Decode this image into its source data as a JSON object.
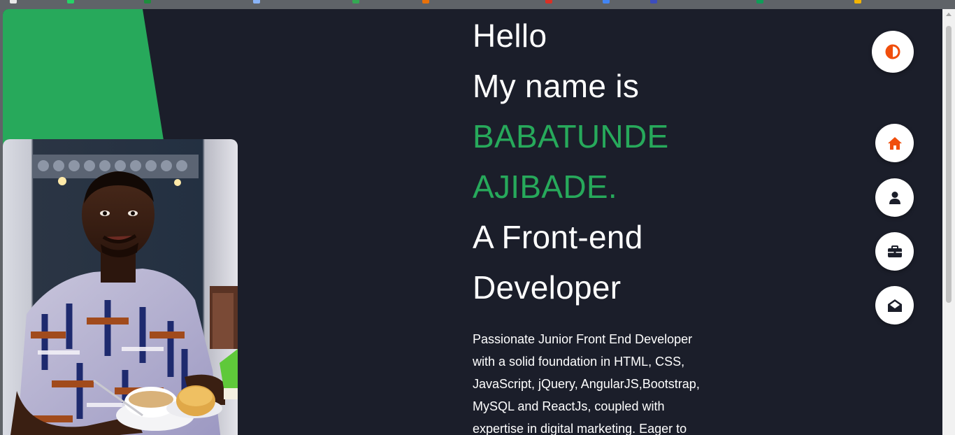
{
  "colors": {
    "background": "#1b1e2a",
    "accent_green": "#27a95b",
    "icon_orange": "#f04e0c",
    "text": "#ffffff"
  },
  "hero": {
    "greeting": "Hello",
    "intro": "My name is",
    "first_name": "BABATUNDE",
    "last_name": "AJIBADE.",
    "role_line1": "A Front-end",
    "role_line2": "Developer"
  },
  "bio": {
    "lines": [
      "Passionate Junior Front End Developer",
      "with a solid foundation in HTML, CSS,",
      "JavaScript, jQuery, AngularJS,Bootstrap,",
      "MySQL and ReactJs, coupled with",
      "expertise in digital marketing. Eager to"
    ]
  },
  "controls": {
    "theme_toggle_icon": "contrast-icon",
    "nav": [
      {
        "id": "home",
        "icon": "home-icon"
      },
      {
        "id": "about",
        "icon": "user-icon"
      },
      {
        "id": "portfolio",
        "icon": "briefcase-icon"
      },
      {
        "id": "contact",
        "icon": "envelope-open-icon"
      }
    ]
  }
}
